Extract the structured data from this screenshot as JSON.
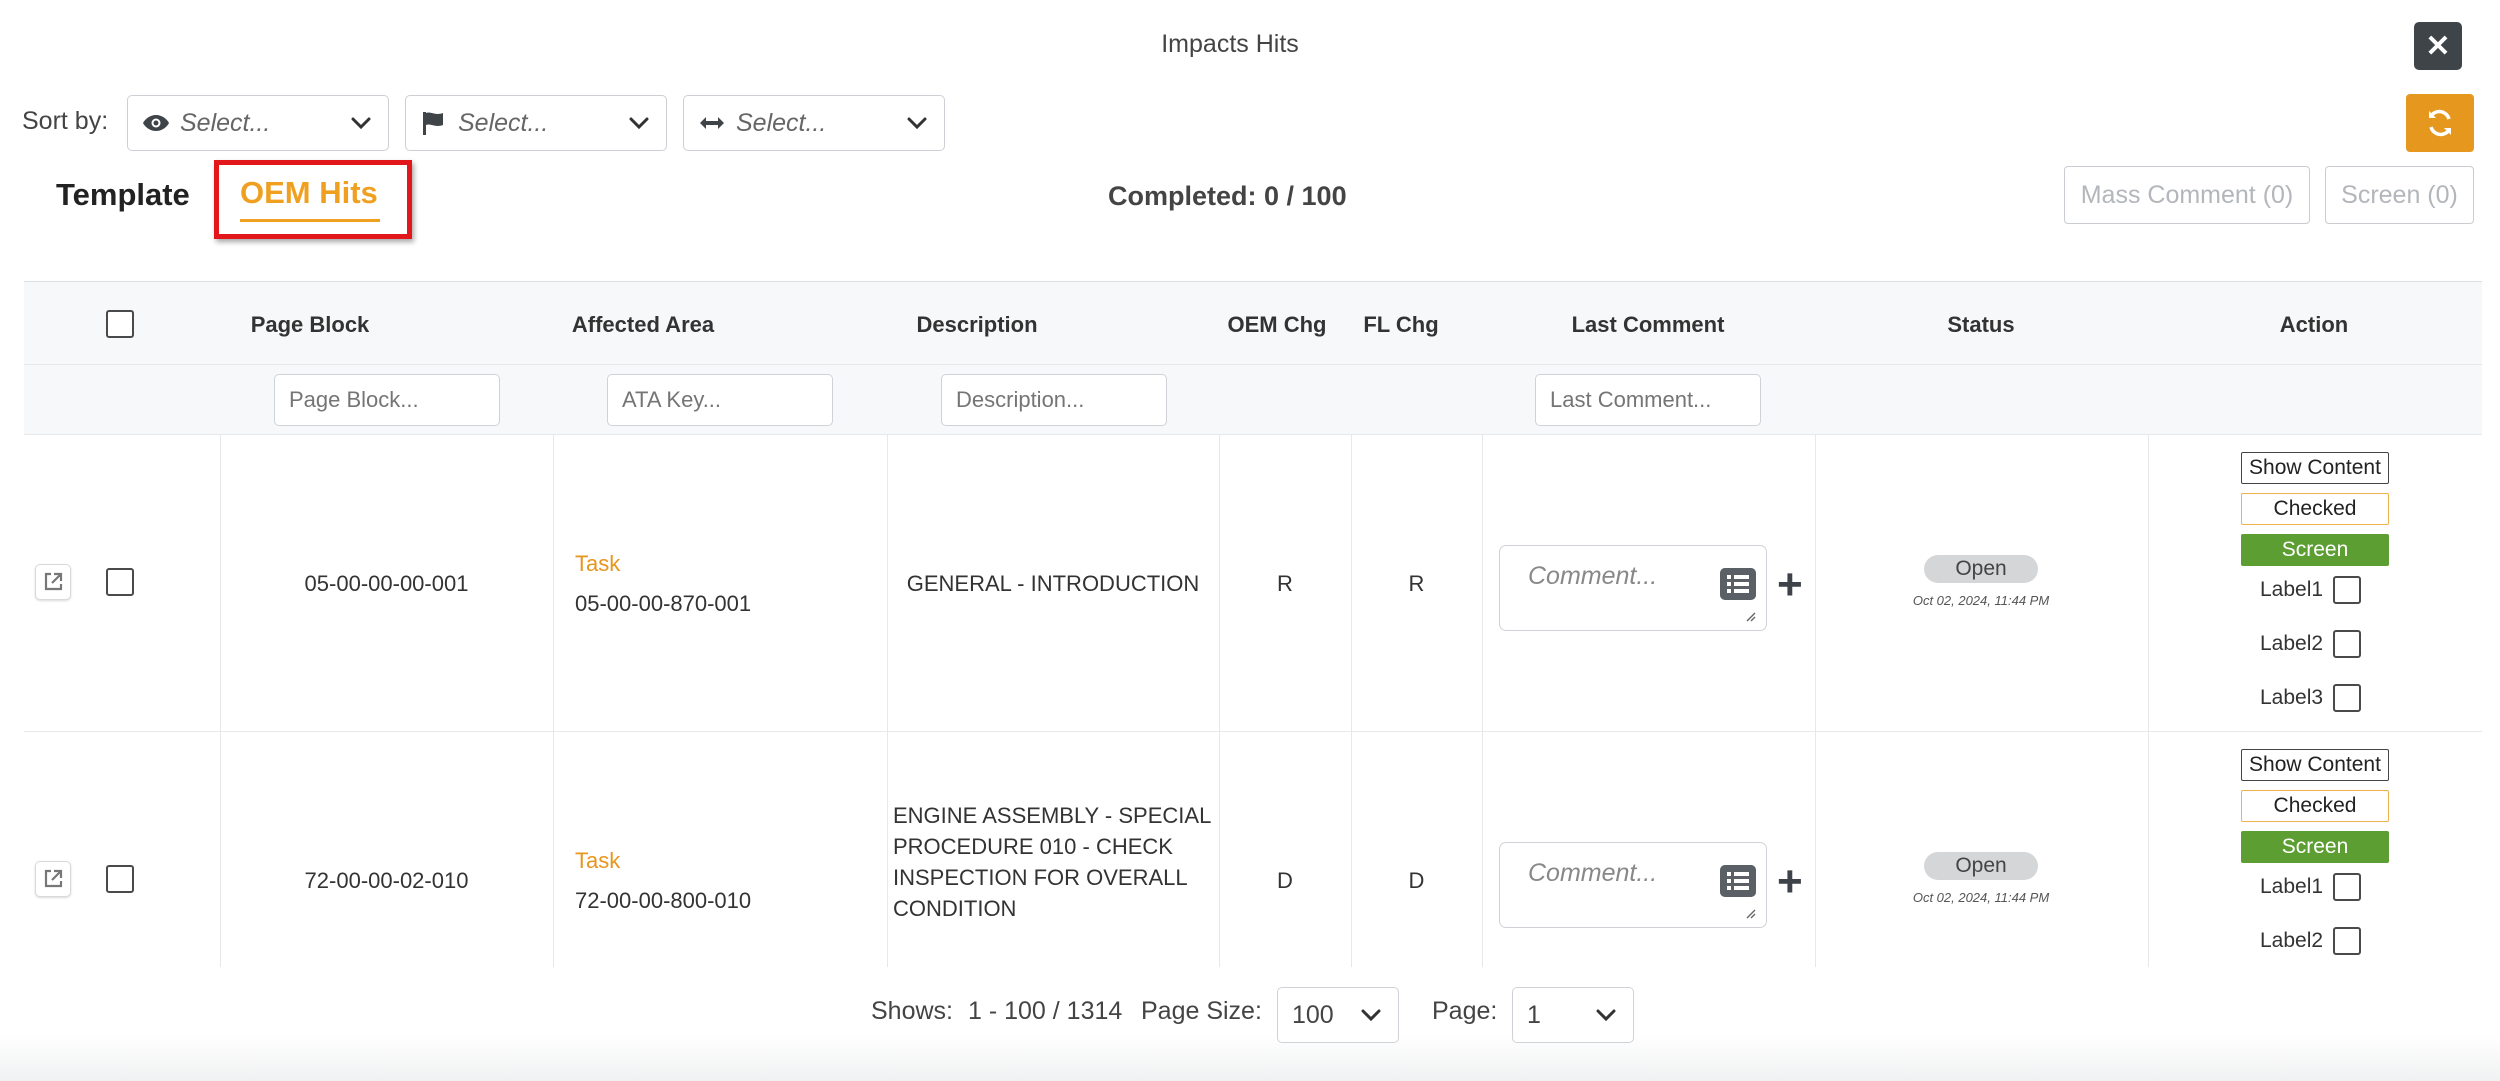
{
  "modal": {
    "title": "Impacts Hits",
    "close_label": "✕"
  },
  "sort": {
    "label": "Sort by:",
    "selects": [
      {
        "icon": "eye-icon",
        "placeholder": "Select..."
      },
      {
        "icon": "flag-icon",
        "placeholder": "Select..."
      },
      {
        "icon": "arrows-horizontal-icon",
        "placeholder": "Select..."
      }
    ]
  },
  "tabs": {
    "template": "Template",
    "oem_hits": "OEM Hits"
  },
  "progress": {
    "label": "Completed:",
    "value": "0 / 100"
  },
  "actions": {
    "mass_comment": "Mass Comment (0)",
    "screen": "Screen (0)"
  },
  "colors": {
    "accent": "#e6971d",
    "screen_green": "#5d9e33",
    "highlight_red": "#e2171b",
    "dark": "#3f4448"
  },
  "table": {
    "headers": {
      "page_block": "Page Block",
      "affected_area": "Affected Area",
      "description": "Description",
      "oem_chg": "OEM Chg",
      "fl_chg": "FL Chg",
      "last_comment": "Last Comment",
      "status": "Status",
      "action": "Action"
    },
    "filters": {
      "page_block": "Page Block...",
      "affected_area": "ATA Key...",
      "description": "Description...",
      "last_comment": "Last Comment..."
    },
    "rows": [
      {
        "page_block": "05-00-00-00-001",
        "area_type": "Task",
        "area_key": "05-00-00-870-001",
        "description": "GENERAL - INTRODUCTION",
        "oem_chg": "R",
        "fl_chg": "R",
        "comment_placeholder": "Comment...",
        "status": "Open",
        "status_time": "Oct 02, 2024, 11:44 PM",
        "show_content": "Show Content",
        "checked": "Checked",
        "screen": "Screen",
        "labels": [
          "Label1",
          "Label2",
          "Label3"
        ]
      },
      {
        "page_block": "72-00-00-02-010",
        "area_type": "Task",
        "area_key": "72-00-00-800-010",
        "description_lines": [
          "ENGINE ASSEMBLY - SPECIAL",
          "PROCEDURE 010 - CHECK",
          "INSPECTION FOR OVERALL",
          "CONDITION"
        ],
        "oem_chg": "D",
        "fl_chg": "D",
        "comment_placeholder": "Comment...",
        "status": "Open",
        "status_time": "Oct 02, 2024, 11:44 PM",
        "show_content": "Show Content",
        "checked": "Checked",
        "screen": "Screen",
        "labels": [
          "Label1",
          "Label2"
        ]
      }
    ]
  },
  "footer": {
    "shows_label": "Shows:",
    "shows_value": "1 - 100 / 1314",
    "page_size_label": "Page Size:",
    "page_size_value": "100",
    "page_label": "Page:",
    "page_value": "1"
  }
}
